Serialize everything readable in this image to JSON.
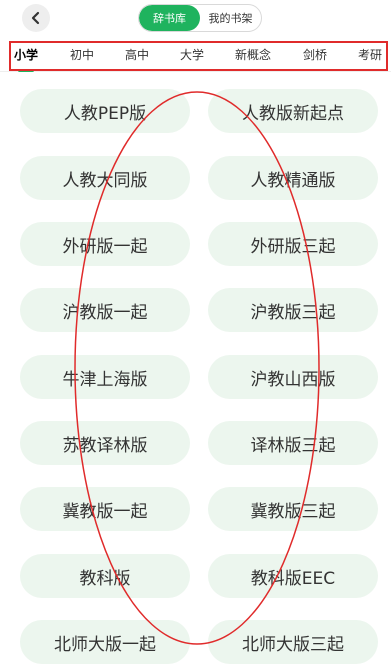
{
  "header": {
    "segments": [
      {
        "label": "辞书库",
        "active": true
      },
      {
        "label": "我的书架",
        "active": false
      }
    ]
  },
  "tabs": [
    {
      "label": "小学",
      "active": true
    },
    {
      "label": "初中",
      "active": false
    },
    {
      "label": "高中",
      "active": false
    },
    {
      "label": "大学",
      "active": false
    },
    {
      "label": "新概念",
      "active": false
    },
    {
      "label": "剑桥",
      "active": false
    },
    {
      "label": "考研",
      "active": false
    }
  ],
  "books": [
    "人教PEP版",
    "人教版新起点",
    "人教大同版",
    "人教精通版",
    "外研版一起",
    "外研版三起",
    "沪教版一起",
    "沪教版三起",
    "牛津上海版",
    "沪教山西版",
    "苏教译林版",
    "译林版三起",
    "冀教版一起",
    "冀教版三起",
    "教科版",
    "教科版EEC",
    "北师大版一起",
    "北师大版三起"
  ],
  "colors": {
    "accent": "#1fb35e",
    "pill_bg": "#ecf6ee",
    "annotation": "#e02b2b"
  },
  "icons": {
    "back": "chevron-left-icon"
  }
}
